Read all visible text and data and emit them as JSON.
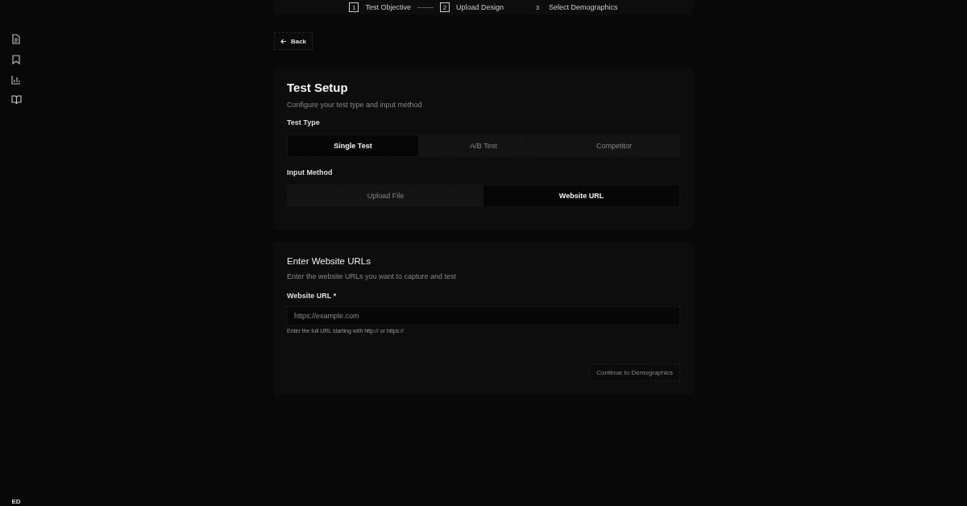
{
  "sidebar": {
    "user_initials": "ED"
  },
  "stepper": {
    "steps": [
      {
        "number": "1",
        "label": "Test Objective",
        "reached": true
      },
      {
        "number": "2",
        "label": "Upload Design",
        "reached": true
      },
      {
        "number": "3",
        "label": "Select Demographics",
        "reached": false
      }
    ]
  },
  "back_button": "Back",
  "setup_card": {
    "title": "Test Setup",
    "subtitle": "Configure your test type and input method",
    "test_type": {
      "label": "Test Type",
      "options": [
        {
          "label": "Single Test",
          "selected": true
        },
        {
          "label": "A/B Test",
          "selected": false
        },
        {
          "label": "Competitor",
          "selected": false
        }
      ]
    },
    "input_method": {
      "label": "Input Method",
      "options": [
        {
          "label": "Upload File",
          "selected": false
        },
        {
          "label": "Website URL",
          "selected": true
        }
      ]
    }
  },
  "url_card": {
    "title": "Enter Website URLs",
    "subtitle": "Enter the website URLs you want to capture and test",
    "field": {
      "label": "Website URL *",
      "placeholder": "https://example.com",
      "hint": "Enter the full URL starting with http:// or https://"
    },
    "continue_button": "Continue to Demographics"
  }
}
